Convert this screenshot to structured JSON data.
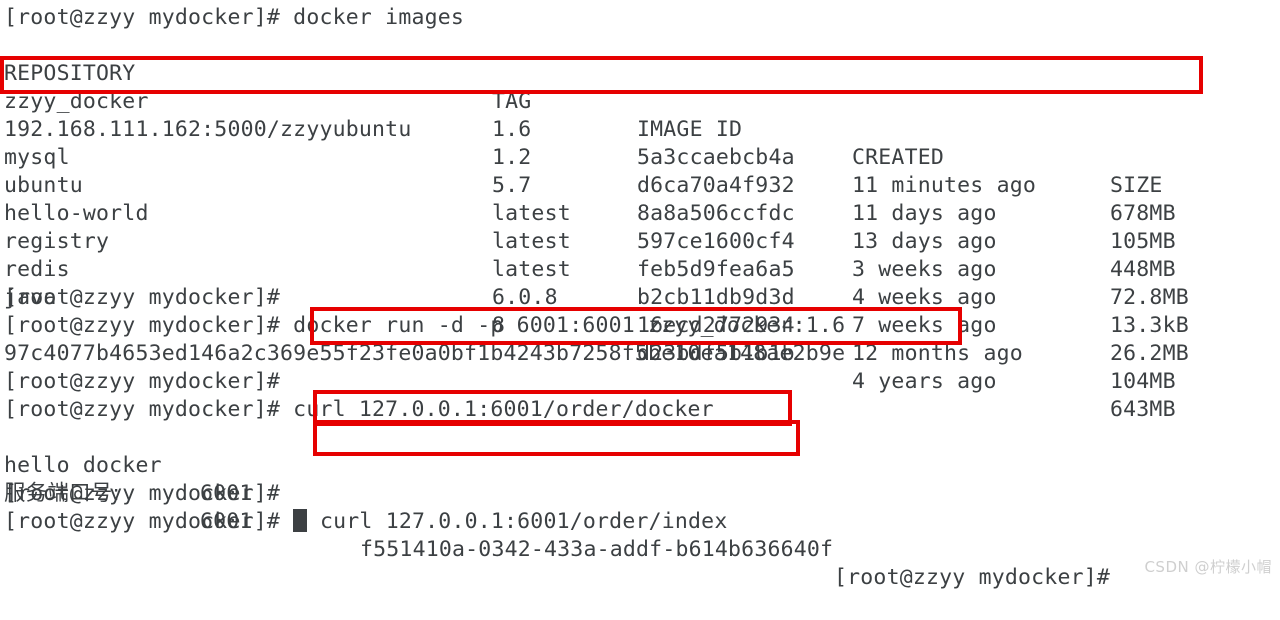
{
  "terminal": {
    "prompt": "[root@zzyy mydocker]# ",
    "colors": {
      "background": "#ffffff",
      "text": "#3c4043",
      "highlight": "#e60000",
      "watermark": "#cfcfcf"
    },
    "command_images": "docker images",
    "table": {
      "headers": [
        "REPOSITORY",
        "TAG",
        "IMAGE ID",
        "CREATED",
        "SIZE"
      ],
      "rows": [
        [
          "zzyy_docker",
          "1.6",
          "5a3ccaebcb4a",
          "11 minutes ago",
          "678MB"
        ],
        [
          "192.168.111.162:5000/zzyyubuntu",
          "1.2",
          "d6ca70a4f932",
          "11 days ago",
          "105MB"
        ],
        [
          "mysql",
          "5.7",
          "8a8a506ccfdc",
          "13 days ago",
          "448MB"
        ],
        [
          "ubuntu",
          "latest",
          "597ce1600cf4",
          "3 weeks ago",
          "72.8MB"
        ],
        [
          "hello-world",
          "latest",
          "feb5d9fea6a5",
          "4 weeks ago",
          "13.3kB"
        ],
        [
          "registry",
          "latest",
          "b2cb11db9d3d",
          "7 weeks ago",
          "26.2MB"
        ],
        [
          "redis",
          "6.0.8",
          "16ecd2772934",
          "12 months ago",
          "104MB"
        ],
        [
          "java",
          "8",
          "d23bdf5b1b1b",
          "4 years ago",
          "643MB"
        ]
      ]
    },
    "command_run": "docker run -d -p 6001:6001 zzyy_docker:1.6",
    "container_id": "97c4077b4653ed146a2c369e55f23fe0a0bf1b4243b7258f5be10ea148ae2b9e",
    "command_curl_docker": "curl 127.0.0.1:6001/order/docker",
    "command_curl_index": "curl 127.0.0.1:6001/order/index",
    "response_docker_label": "hello docker",
    "response_docker_port": "6001",
    "response_index_label": "服务端口号:",
    "response_index_port": "6001",
    "response_index_uuid": "f551410a-0342-433a-addf-b614b636640f",
    "cursor": "block-cursor"
  },
  "watermark": "CSDN @柠檬小帽"
}
